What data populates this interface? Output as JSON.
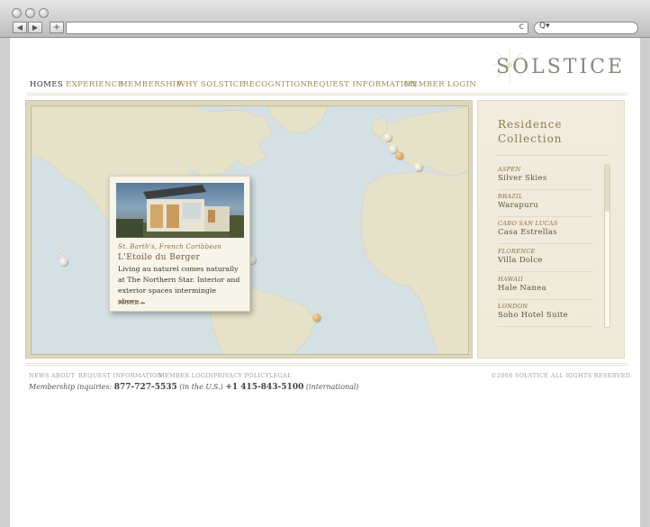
{
  "browser": {
    "back_label": "◀",
    "forward_label": "▶",
    "add_label": "+",
    "reload_label": "c",
    "search_label": "Q▾"
  },
  "logo": "SOLSTICE",
  "nav": [
    "Homes",
    "Experience",
    "Membership",
    "Why Solstice",
    "Recognition",
    "Request Information",
    "Member Login"
  ],
  "popup": {
    "location": "St. Barth's, French Caribbean",
    "name": "L'Etoile du Berger",
    "description": "Living au naturel comes naturally at The Northern Star. Interior and exterior spaces intermingle above...",
    "more": "MORE ▸"
  },
  "residence": {
    "title_line1": "Residence",
    "title_line2": "Collection",
    "items": [
      {
        "region": "ASPEN",
        "name": "Silver Skies"
      },
      {
        "region": "BRAZIL",
        "name": "Warapuru"
      },
      {
        "region": "CABO SAN LUCAS",
        "name": "Casa Estrellas"
      },
      {
        "region": "FLORENCE",
        "name": "Villa Dolce"
      },
      {
        "region": "HAWAII",
        "name": "Hale Nanea"
      },
      {
        "region": "LONDON",
        "name": "Soho Hotel Suite"
      }
    ]
  },
  "footer": {
    "links": [
      "NEWS",
      "ABOUT",
      "REQUEST INFORMATION",
      "MEMBER LOGIN",
      "PRIVACY POLICY",
      "LEGAL"
    ],
    "copyright": "©2008 SOLSTICE ALL RIGHTS RESERVED.",
    "inq_label": "Membership inquiries:",
    "phone_us": "877-727-5535",
    "us_note": "(in the U.S.)",
    "phone_intl": "+1 415-843-5100",
    "intl_note": "(international)"
  }
}
